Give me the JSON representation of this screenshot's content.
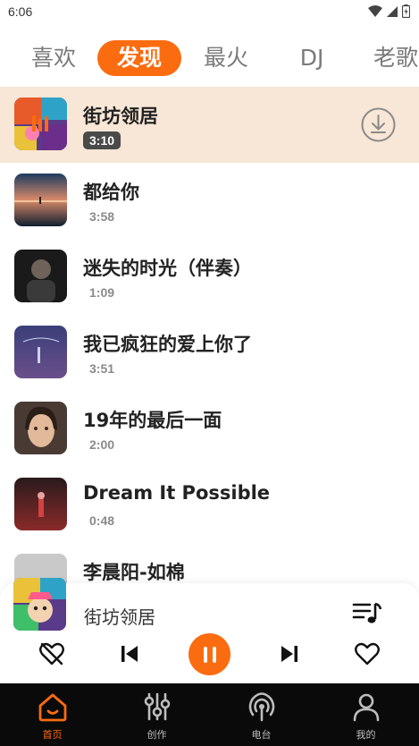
{
  "status_bar": {
    "time": "6:06"
  },
  "tabs": [
    {
      "label": "喜欢",
      "active": false
    },
    {
      "label": "发现",
      "active": true
    },
    {
      "label": "最火",
      "active": false
    },
    {
      "label": "DJ",
      "active": false
    },
    {
      "label": "老歌",
      "active": false
    }
  ],
  "songs": [
    {
      "title": "街坊领居",
      "duration": "3:10",
      "playing": true
    },
    {
      "title": "都给你",
      "duration": "3:58",
      "playing": false
    },
    {
      "title": "迷失的时光（伴奏）",
      "duration": "1:09",
      "playing": false
    },
    {
      "title": "我已疯狂的爱上你了",
      "duration": "3:51",
      "playing": false
    },
    {
      "title": "19年的最后一面",
      "duration": "2:00",
      "playing": false
    },
    {
      "title": "Dream It Possible",
      "duration": "0:48",
      "playing": false
    },
    {
      "title": "李晨阳-如棉",
      "duration": "",
      "playing": false
    }
  ],
  "player": {
    "title": "街坊领居",
    "state": "playing"
  },
  "bottom_nav": [
    {
      "label": "首页",
      "icon": "home-icon",
      "active": true
    },
    {
      "label": "创作",
      "icon": "sliders-icon",
      "active": false
    },
    {
      "label": "电台",
      "icon": "radio-icon",
      "active": false
    },
    {
      "label": "我的",
      "icon": "profile-icon",
      "active": false
    }
  ],
  "colors": {
    "accent": "#fb6b10",
    "playing_row": "#f8e7d6",
    "nav_bg": "#0a0a0a"
  }
}
